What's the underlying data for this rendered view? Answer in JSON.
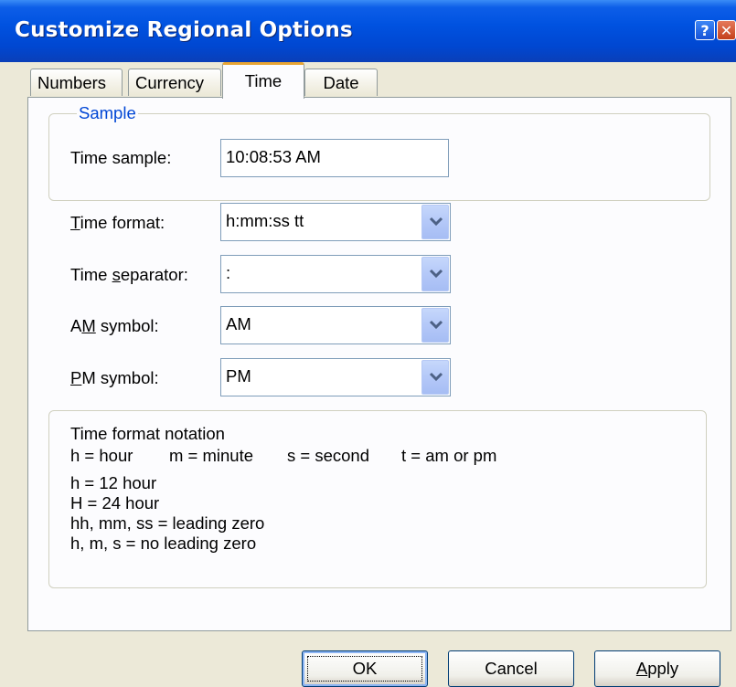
{
  "window": {
    "title": "Customize Regional Options",
    "help_glyph": "?",
    "close_glyph": "✕"
  },
  "tabs": [
    {
      "label": "Numbers"
    },
    {
      "label": "Currency"
    },
    {
      "label": "Time"
    },
    {
      "label": "Date"
    }
  ],
  "sample": {
    "group_title": "Sample",
    "label": "Time sample:",
    "value": "10:08:53 AM"
  },
  "fields": {
    "time_format": {
      "label_mnemonic": "T",
      "label_rest": "ime format:",
      "value": "h:mm:ss tt"
    },
    "time_separator": {
      "label_pre": "Time ",
      "label_mnemonic": "s",
      "label_rest": "eparator:",
      "value": ":"
    },
    "am_symbol": {
      "label_pre": "A",
      "label_mnemonic": "M",
      "label_rest": " symbol:",
      "value": "AM"
    },
    "pm_symbol": {
      "label_mnemonic": "P",
      "label_rest": "M symbol:",
      "value": "PM"
    }
  },
  "notation": {
    "title": "Time format notation",
    "legend_h": "h = hour",
    "legend_m": "m = minute",
    "legend_s": "s = second",
    "legend_t": "t = am or pm",
    "lines": [
      "h = 12 hour",
      "H = 24 hour",
      "hh, mm, ss = leading zero",
      "h, m, s = no leading zero"
    ]
  },
  "buttons": {
    "ok": "OK",
    "cancel": "Cancel",
    "apply_mnemonic": "A",
    "apply_rest": "pply"
  },
  "colors": {
    "titlebar": "#0052e0",
    "group_title": "#0046d5",
    "active_tab_accent": "#e8a534",
    "combo_arrow": "#4d6185"
  },
  "icons": {
    "help": "help-icon",
    "close": "close-icon",
    "dropdown": "chevron-down-icon"
  }
}
